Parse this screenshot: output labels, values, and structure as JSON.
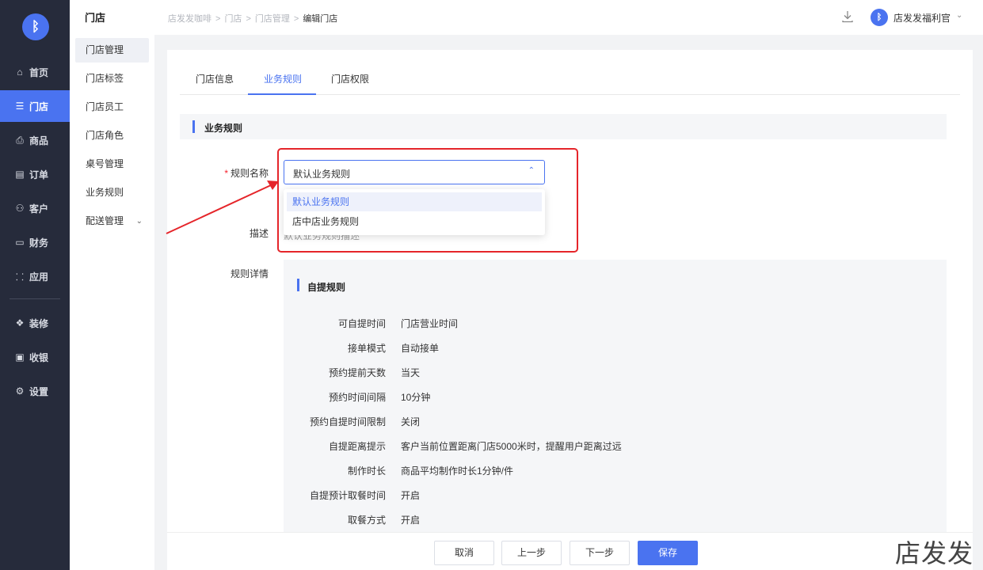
{
  "nav": {
    "logo": "ᛒ",
    "items": [
      {
        "icon": "⌂",
        "label": "首页",
        "active": false
      },
      {
        "icon": "☰",
        "label": "门店",
        "active": true
      },
      {
        "icon": "⎙",
        "label": "商品",
        "active": false
      },
      {
        "icon": "▤",
        "label": "订单",
        "active": false
      },
      {
        "icon": "⚇",
        "label": "客户",
        "active": false
      },
      {
        "icon": "▭",
        "label": "财务",
        "active": false
      },
      {
        "icon": "⸬",
        "label": "应用",
        "active": false
      },
      {
        "icon": "❖",
        "label": "装修",
        "active": false
      },
      {
        "icon": "▣",
        "label": "收银",
        "active": false
      },
      {
        "icon": "⚙",
        "label": "设置",
        "active": false
      }
    ]
  },
  "subnav": {
    "title": "门店",
    "items": [
      "门店管理",
      "门店标签",
      "门店员工",
      "门店角色",
      "桌号管理",
      "业务规则",
      "配送管理"
    ],
    "expand_chevron": "⌄"
  },
  "header": {
    "breadcrumbs": [
      "店发发咖啡",
      "门店",
      "门店管理",
      "编辑门店"
    ],
    "separator": ">",
    "user_name": "店发发福利官",
    "avatar": "ᛒ",
    "user_chevron": "⌄"
  },
  "tabs": [
    "门店信息",
    "业务规则",
    "门店权限"
  ],
  "section_title": "业务规则",
  "form": {
    "rule_name_label": "规则名称",
    "required_mark": "*",
    "rule_name_value": "默认业务规则",
    "select_arrow": "⌃",
    "options": [
      "默认业务规则",
      "店中店业务规则"
    ],
    "desc_label": "描述",
    "desc_value": "默认业务规则描述",
    "detail_label": "规则详情"
  },
  "detail": {
    "title": "自提规则",
    "rows": [
      {
        "label": "可自提时间",
        "value": "门店营业时间"
      },
      {
        "label": "接单模式",
        "value": "自动接单"
      },
      {
        "label": "预约提前天数",
        "value": "当天"
      },
      {
        "label": "预约时间间隔",
        "value": "10分钟"
      },
      {
        "label": "预约自提时间限制",
        "value": "关闭"
      },
      {
        "label": "自提距离提示",
        "value": "客户当前位置距离门店5000米时，提醒用户距离过远"
      },
      {
        "label": "制作时长",
        "value": "商品平均制作时长1分钟/件"
      },
      {
        "label": "自提预计取餐时间",
        "value": "开启"
      },
      {
        "label": "取餐方式",
        "value": "开启"
      }
    ]
  },
  "footer": {
    "cancel": "取消",
    "prev": "上一步",
    "next": "下一步",
    "save": "保存"
  },
  "watermark": "店发发",
  "colors": {
    "accent": "#4a73f0",
    "nav_bg": "#262b3b",
    "annotation": "#e5252a"
  }
}
